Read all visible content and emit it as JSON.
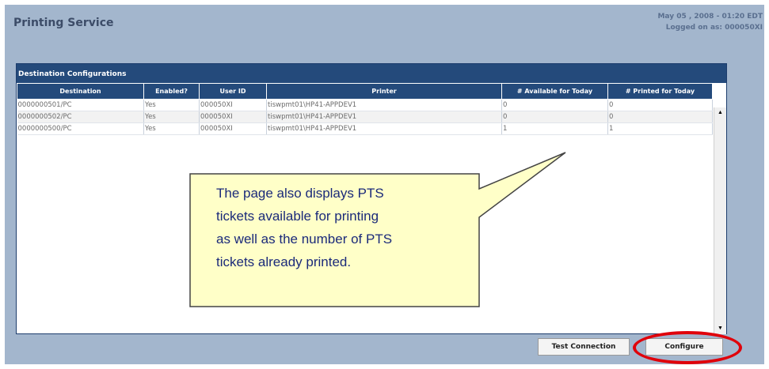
{
  "header": {
    "title": "Printing Service",
    "datetime": "May 05 , 2008 - 01:20 EDT",
    "logged_on": "Logged on as: 000050XI"
  },
  "panel": {
    "title": "Destination Configurations",
    "columns": [
      "Destination",
      "Enabled?",
      "User ID",
      "Printer",
      "# Available for Today",
      "# Printed for Today"
    ],
    "rows": [
      [
        "0000000501/PC",
        "Yes",
        "000050XI",
        "tiswpmt01\\HP41-APPDEV1",
        "0",
        "0"
      ],
      [
        "0000000502/PC",
        "Yes",
        "000050XI",
        "tiswpmt01\\HP41-APPDEV1",
        "0",
        "0"
      ],
      [
        "0000000500/PC",
        "Yes",
        "000050XI",
        "tiswpmt01\\HP41-APPDEV1",
        "1",
        "1"
      ]
    ]
  },
  "buttons": {
    "test_connection": "Test Connection",
    "configure": "Configure"
  },
  "callout": {
    "lines": [
      "The page also displays PTS",
      "tickets available for printing",
      "as well as the number of PTS",
      "tickets already printed."
    ],
    "highlight_color": "#e0000a",
    "fill_color": "#ffffc8"
  }
}
